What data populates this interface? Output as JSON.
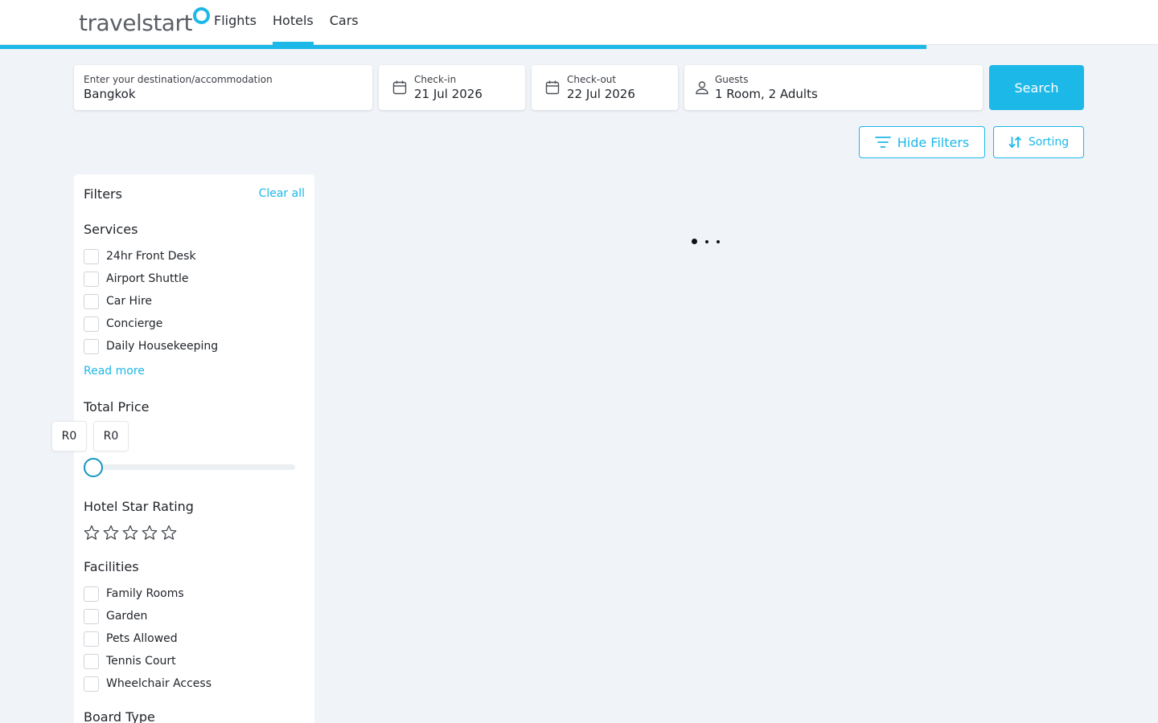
{
  "brand": {
    "name": "travelstart",
    "accent": "#1cb8e8"
  },
  "nav": {
    "items": [
      {
        "label": "Flights"
      },
      {
        "label": "Hotels",
        "active": true
      },
      {
        "label": "Cars"
      }
    ]
  },
  "loading_progress": 0.8,
  "search": {
    "destination_label": "Enter your destination/accommodation",
    "destination_value": "Bangkok",
    "checkin_label": "Check-in",
    "checkin_value": "21 Jul 2026",
    "checkout_label": "Check-out",
    "checkout_value": "22 Jul 2026",
    "guests_label": "Guests",
    "guests_value": "1 Room, 2 Adults",
    "search_button": "Search",
    "icons": {
      "checkin": "calendar-icon",
      "checkout": "calendar-icon",
      "guests": "person-icon"
    }
  },
  "toolbar": {
    "hide_filters": "Hide Filters",
    "sorting": "Sorting",
    "icons": {
      "hide_filters": "filter-lines-icon",
      "sorting": "sort-arrows-icon"
    }
  },
  "filters": {
    "title": "Filters",
    "clear_all": "Clear all",
    "services": {
      "title": "Services",
      "items": [
        "24hr Front Desk",
        "Airport Shuttle",
        "Car Hire",
        "Concierge",
        "Daily Housekeeping"
      ],
      "read_more": "Read more"
    },
    "total_price": {
      "title": "Total Price",
      "min": "R0",
      "max": "R0",
      "slider_fraction": 0
    },
    "star_rating": {
      "title": "Hotel Star Rating",
      "max_stars": 5,
      "selected": 0
    },
    "facilities": {
      "title": "Facilities",
      "items": [
        "Family Rooms",
        "Garden",
        "Pets Allowed",
        "Tennis Court",
        "Wheelchair Access"
      ]
    },
    "board_type": {
      "title": "Board Type"
    }
  },
  "results": {
    "state": "loading"
  }
}
